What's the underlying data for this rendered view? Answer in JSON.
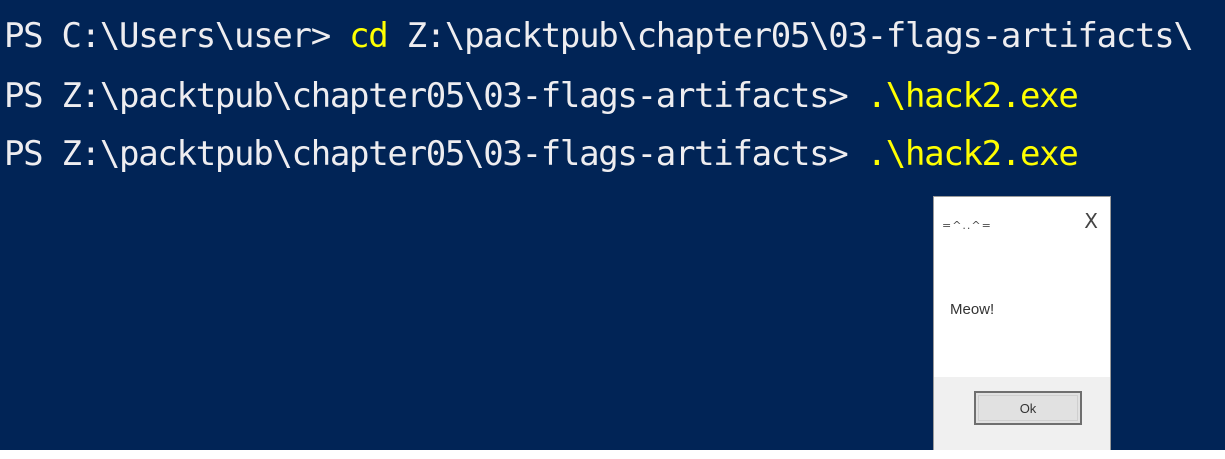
{
  "terminal": {
    "line1": {
      "prompt": "PS C:\\Users\\user> ",
      "command": "cd",
      "argument": " Z:\\packtpub\\chapter05\\03-flags-artifacts\\"
    },
    "line2": {
      "prompt": "PS Z:\\packtpub\\chapter05\\03-flags-artifacts> ",
      "command": ".\\hack2.exe"
    },
    "line3": {
      "prompt": "PS Z:\\packtpub\\chapter05\\03-flags-artifacts> ",
      "command": ".\\hack2.exe"
    },
    "colors": {
      "background": "#012456",
      "text": "#eeedf0",
      "command": "#ffff00"
    }
  },
  "message_box": {
    "title": "=^..^=",
    "close_glyph": "X",
    "message": "Meow!",
    "ok_label": "Ok"
  }
}
